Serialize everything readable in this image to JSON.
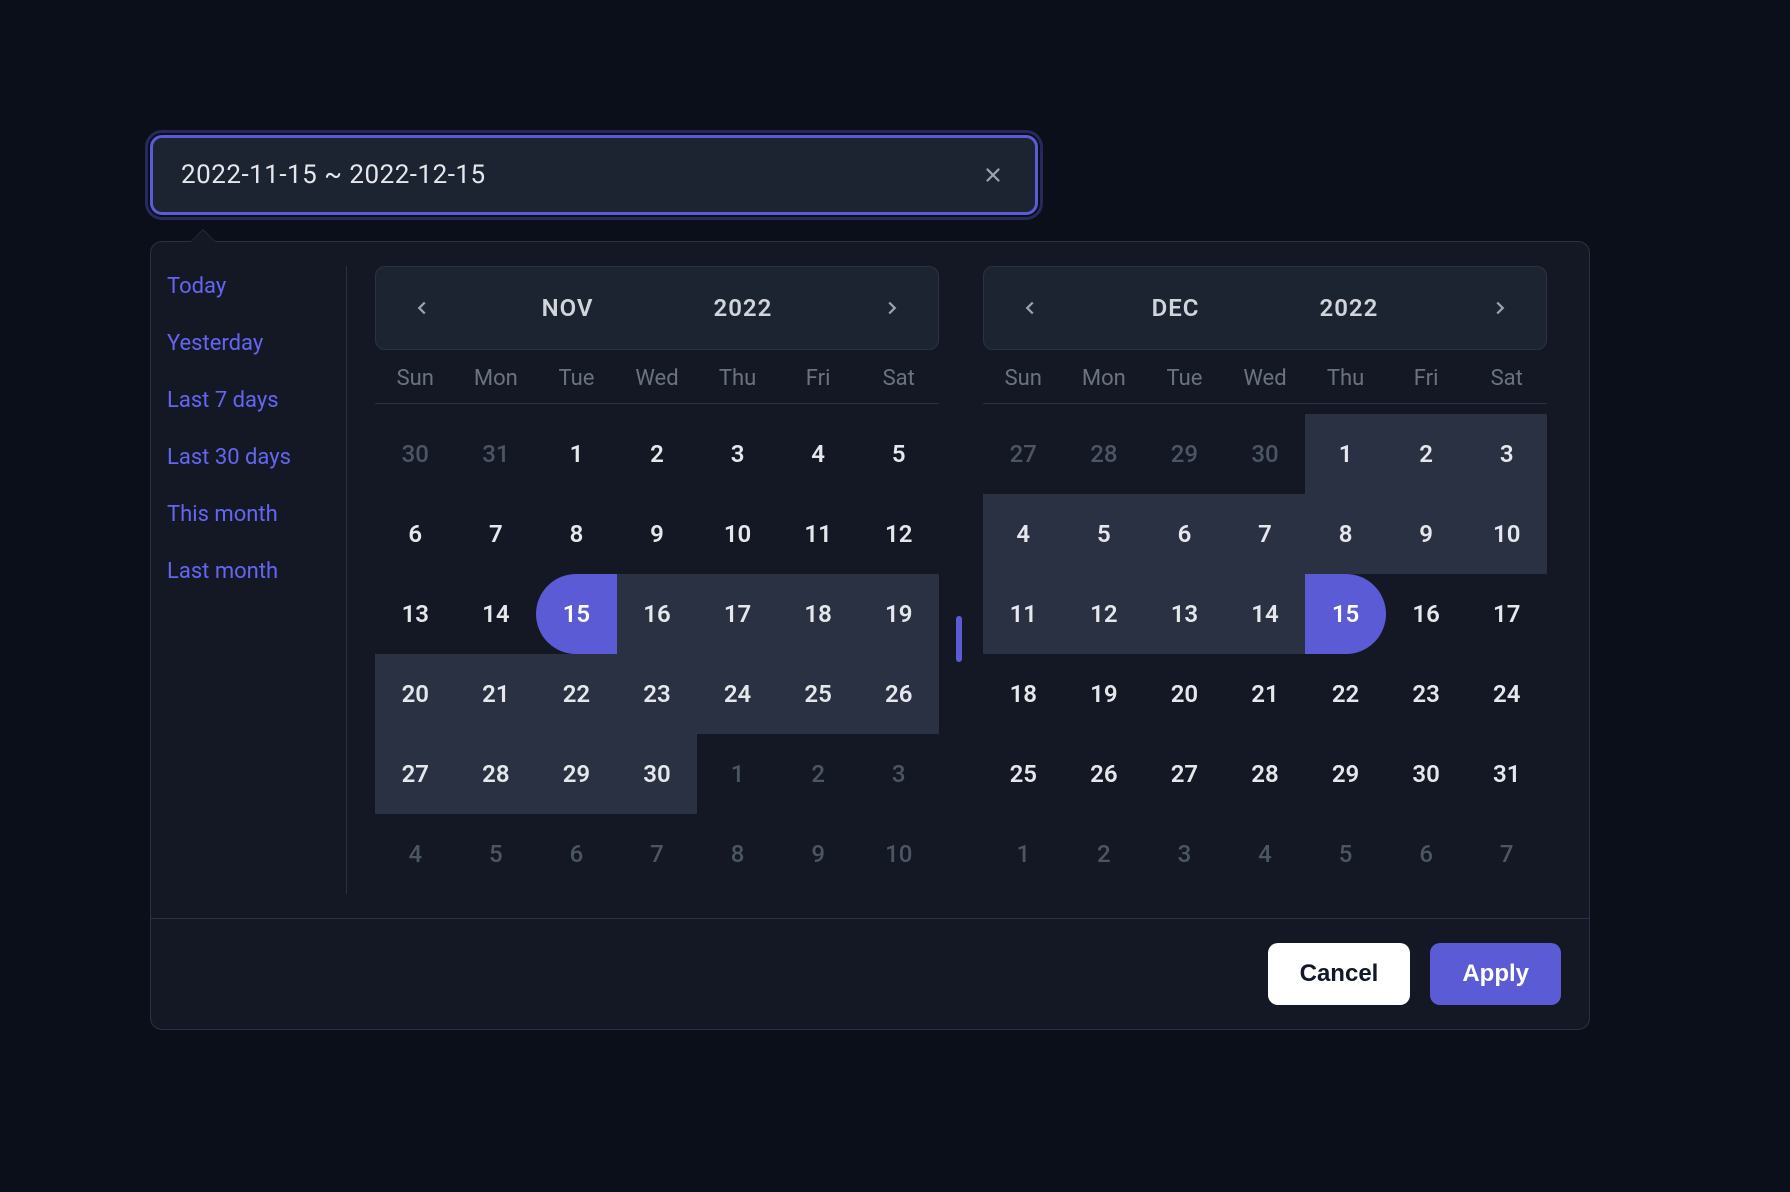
{
  "input": {
    "value": "2022-11-15 ~ 2022-12-15"
  },
  "shortcuts": [
    "Today",
    "Yesterday",
    "Last 7 days",
    "Last 30 days",
    "This month",
    "Last month"
  ],
  "calendars": {
    "weekdays": [
      "Sun",
      "Mon",
      "Tue",
      "Wed",
      "Thu",
      "Fri",
      "Sat"
    ],
    "left": {
      "month": "NOV",
      "year": "2022",
      "days": [
        {
          "n": "30",
          "out": true
        },
        {
          "n": "31",
          "out": true
        },
        {
          "n": "1"
        },
        {
          "n": "2"
        },
        {
          "n": "3"
        },
        {
          "n": "4"
        },
        {
          "n": "5"
        },
        {
          "n": "6"
        },
        {
          "n": "7"
        },
        {
          "n": "8"
        },
        {
          "n": "9"
        },
        {
          "n": "10"
        },
        {
          "n": "11"
        },
        {
          "n": "12"
        },
        {
          "n": "13"
        },
        {
          "n": "14"
        },
        {
          "n": "15",
          "start": true
        },
        {
          "n": "16",
          "range": true
        },
        {
          "n": "17",
          "range": true
        },
        {
          "n": "18",
          "range": true
        },
        {
          "n": "19",
          "range": true
        },
        {
          "n": "20",
          "range": true
        },
        {
          "n": "21",
          "range": true
        },
        {
          "n": "22",
          "range": true
        },
        {
          "n": "23",
          "range": true
        },
        {
          "n": "24",
          "range": true
        },
        {
          "n": "25",
          "range": true
        },
        {
          "n": "26",
          "range": true
        },
        {
          "n": "27",
          "range": true
        },
        {
          "n": "28",
          "range": true
        },
        {
          "n": "29",
          "range": true
        },
        {
          "n": "30",
          "range": true
        },
        {
          "n": "1",
          "out": true
        },
        {
          "n": "2",
          "out": true
        },
        {
          "n": "3",
          "out": true
        },
        {
          "n": "4",
          "out": true
        },
        {
          "n": "5",
          "out": true
        },
        {
          "n": "6",
          "out": true
        },
        {
          "n": "7",
          "out": true
        },
        {
          "n": "8",
          "out": true
        },
        {
          "n": "9",
          "out": true
        },
        {
          "n": "10",
          "out": true
        }
      ]
    },
    "right": {
      "month": "DEC",
      "year": "2022",
      "days": [
        {
          "n": "27",
          "out": true
        },
        {
          "n": "28",
          "out": true
        },
        {
          "n": "29",
          "out": true
        },
        {
          "n": "30",
          "out": true
        },
        {
          "n": "1",
          "range": true
        },
        {
          "n": "2",
          "range": true
        },
        {
          "n": "3",
          "range": true
        },
        {
          "n": "4",
          "range": true
        },
        {
          "n": "5",
          "range": true
        },
        {
          "n": "6",
          "range": true
        },
        {
          "n": "7",
          "range": true
        },
        {
          "n": "8",
          "range": true
        },
        {
          "n": "9",
          "range": true
        },
        {
          "n": "10",
          "range": true
        },
        {
          "n": "11",
          "range": true
        },
        {
          "n": "12",
          "range": true
        },
        {
          "n": "13",
          "range": true
        },
        {
          "n": "14",
          "range": true
        },
        {
          "n": "15",
          "end": true
        },
        {
          "n": "16"
        },
        {
          "n": "17"
        },
        {
          "n": "18"
        },
        {
          "n": "19"
        },
        {
          "n": "20"
        },
        {
          "n": "21"
        },
        {
          "n": "22"
        },
        {
          "n": "23"
        },
        {
          "n": "24"
        },
        {
          "n": "25"
        },
        {
          "n": "26"
        },
        {
          "n": "27"
        },
        {
          "n": "28"
        },
        {
          "n": "29"
        },
        {
          "n": "30"
        },
        {
          "n": "31"
        },
        {
          "n": "1",
          "out": true
        },
        {
          "n": "2",
          "out": true
        },
        {
          "n": "3",
          "out": true
        },
        {
          "n": "4",
          "out": true
        },
        {
          "n": "5",
          "out": true
        },
        {
          "n": "6",
          "out": true
        },
        {
          "n": "7",
          "out": true
        }
      ]
    }
  },
  "footer": {
    "cancel": "Cancel",
    "apply": "Apply"
  }
}
